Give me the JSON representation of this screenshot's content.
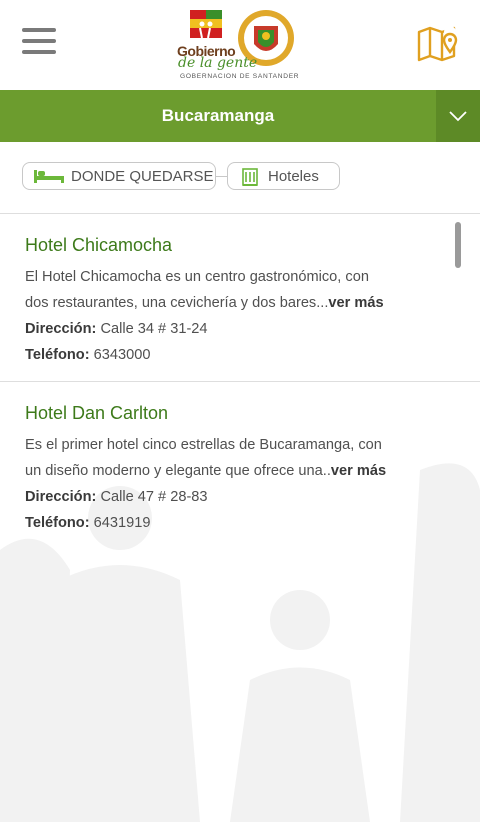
{
  "header": {
    "logo": {
      "title": "Gobierno",
      "script": "de la gente",
      "subtitle": "GOBERNACION DE SANTANDER"
    },
    "icons": {
      "menu": "hamburger-menu-icon",
      "map": "map-icon"
    },
    "accent_color": "#e0a020"
  },
  "city_selector": {
    "selected": "Bucaramanga",
    "bar_color": "#6c9c2e"
  },
  "breadcrumb": [
    {
      "label": "DONDE QUEDARSE",
      "icon": "bed-icon"
    },
    {
      "label": "Hoteles",
      "icon": "building-icon"
    }
  ],
  "listings": [
    {
      "title": "Hotel Chicamocha",
      "description_line1": "El Hotel Chicamocha es un centro gastronómico, con",
      "description_line2": "dos restaurantes, una cevichería y dos bares...",
      "more_label": "ver más",
      "address_label": "Dirección:",
      "address": "Calle 34 # 31-24",
      "phone_label": "Teléfono:",
      "phone": "6343000"
    },
    {
      "title": "Hotel Dan Carlton",
      "description_line1": "Es el primer hotel cinco estrellas de Bucaramanga, con",
      "description_line2": "un diseño moderno y elegante que ofrece una..",
      "more_label": "ver más",
      "address_label": "Dirección:",
      "address": "Calle 47 # 28-83",
      "phone_label": "Teléfono:",
      "phone": "6431919"
    }
  ],
  "theme": {
    "primary_green": "#6c9c2e",
    "title_green": "#3d7a1a"
  }
}
